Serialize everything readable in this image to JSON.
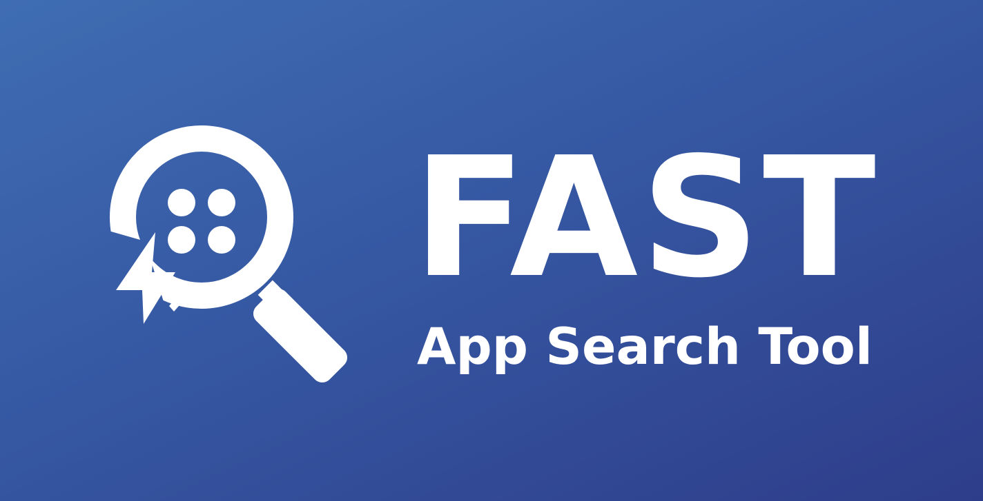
{
  "brand": {
    "title": "FAST",
    "subtitle": "App Search Tool",
    "icon": "magnifier-bolt-dots-icon"
  },
  "colors": {
    "background_start": "#3f6db3",
    "background_end": "#2e3d8a",
    "foreground": "#ffffff"
  }
}
